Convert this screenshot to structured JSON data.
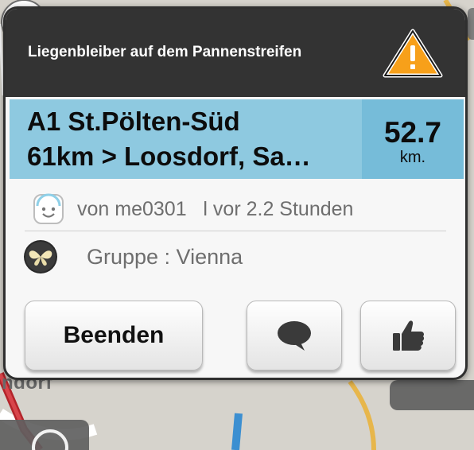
{
  "alert": {
    "title": "Liegenbleiber auf dem Pannenstreifen",
    "icon": "warning-icon"
  },
  "route": {
    "line1": "A1 St.Pölten-Süd",
    "line2": "61km > Loosdorf, Sa…"
  },
  "distance": {
    "value": "52.7",
    "unit": "km."
  },
  "reporter": {
    "text": "von me0301   l vor 2.2 Stunden",
    "icon": "smiley-icon"
  },
  "group": {
    "text": "Gruppe : Vienna",
    "icon": "butterfly-icon"
  },
  "buttons": {
    "end_label": "Beenden",
    "comment_icon": "speech-bubble-icon",
    "like_icon": "thumbs-up-icon"
  },
  "map": {
    "street_label": "ndorf"
  },
  "colors": {
    "header_bg": "#333333",
    "route_band": "#8ec9e0",
    "distance_box": "#76bcd9",
    "warning_orange": "#f7a01a",
    "map_route_blue": "#3c8fd1"
  }
}
